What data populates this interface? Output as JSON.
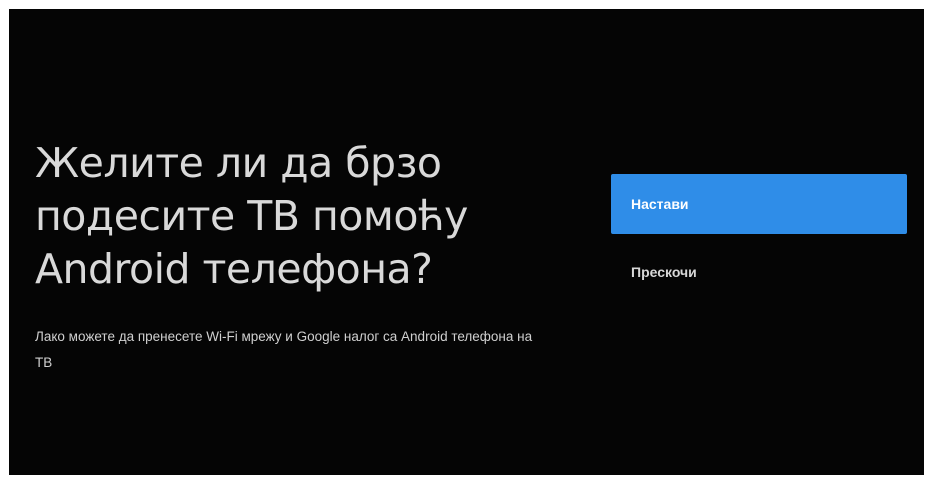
{
  "screen": {
    "title_lines": [
      "Желите ли да брзо",
      "подесите ТВ помоћу",
      "Android телефона?"
    ],
    "subtitle": "Лако можете да пренесете Wi-Fi мрежу и Google налог са Android телефона на ТВ"
  },
  "actions": {
    "continue_label": "Настави",
    "skip_label": "Прескочи"
  },
  "colors": {
    "background": "#050505",
    "accent": "#2f8de8",
    "text": "#d9d9d9"
  }
}
